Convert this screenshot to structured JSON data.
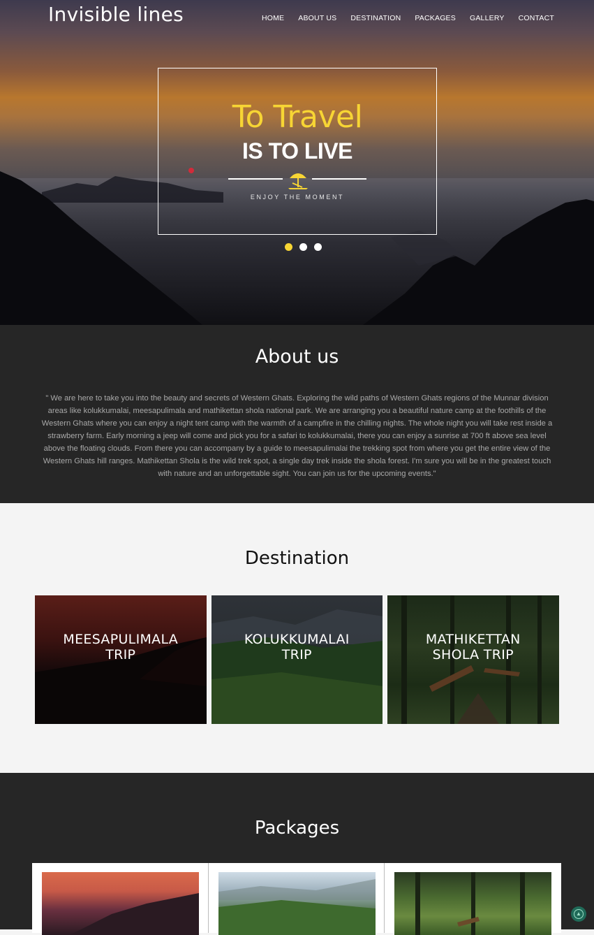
{
  "header": {
    "brand": "Invisible lines",
    "nav": [
      "HOME",
      "ABOUT US",
      "DESTINATION",
      "PACKAGES",
      "GALLERY",
      "CONTACT"
    ]
  },
  "hero": {
    "title_line1": "To Travel",
    "title_line2": "IS TO LIVE",
    "subtitle": "ENJOY THE MOMENT",
    "slides_count": 3,
    "active_slide": 1,
    "accent_color": "#f7d534",
    "icon": "beach-umbrella-icon"
  },
  "about": {
    "heading": "About us",
    "text": "\" We are here to take you into the beauty and secrets of Western Ghats. Exploring the wild paths of Western Ghats regions of the Munnar division areas like kolukkumalai, meesapulimala and mathikettan shola national park. We are arranging you a beautiful nature camp at the foothills of the Western Ghats where you can enjoy a night tent camp with the warmth of a campfire in the chilling nights. The whole night you will take rest inside a strawberry farm. Early morning a jeep will come and pick you for a safari to kolukkumalai, there you can enjoy a sunrise at 700 ft above sea level above the floating clouds. From there you can accompany by a guide to meesapulimalai the trekking spot from where you get the entire view of the Western Ghats hill ranges. Mathikettan Shola is the wild trek spot, a single day trek inside the shola forest. I'm sure you will be in the greatest touch with nature and an unforgettable sight. You can join us for the upcoming events.\""
  },
  "destination": {
    "heading": "Destination",
    "cards": [
      {
        "line1": "MEESAPULIMALA",
        "line2": "TRIP"
      },
      {
        "line1": "KOLUKKUMALAI",
        "line2": "TRIP"
      },
      {
        "line1": "MATHIKETTAN",
        "line2": "SHOLA TRIP"
      }
    ]
  },
  "packages": {
    "heading": "Packages"
  },
  "back_to_top_icon": "arrow-up-circle-icon"
}
